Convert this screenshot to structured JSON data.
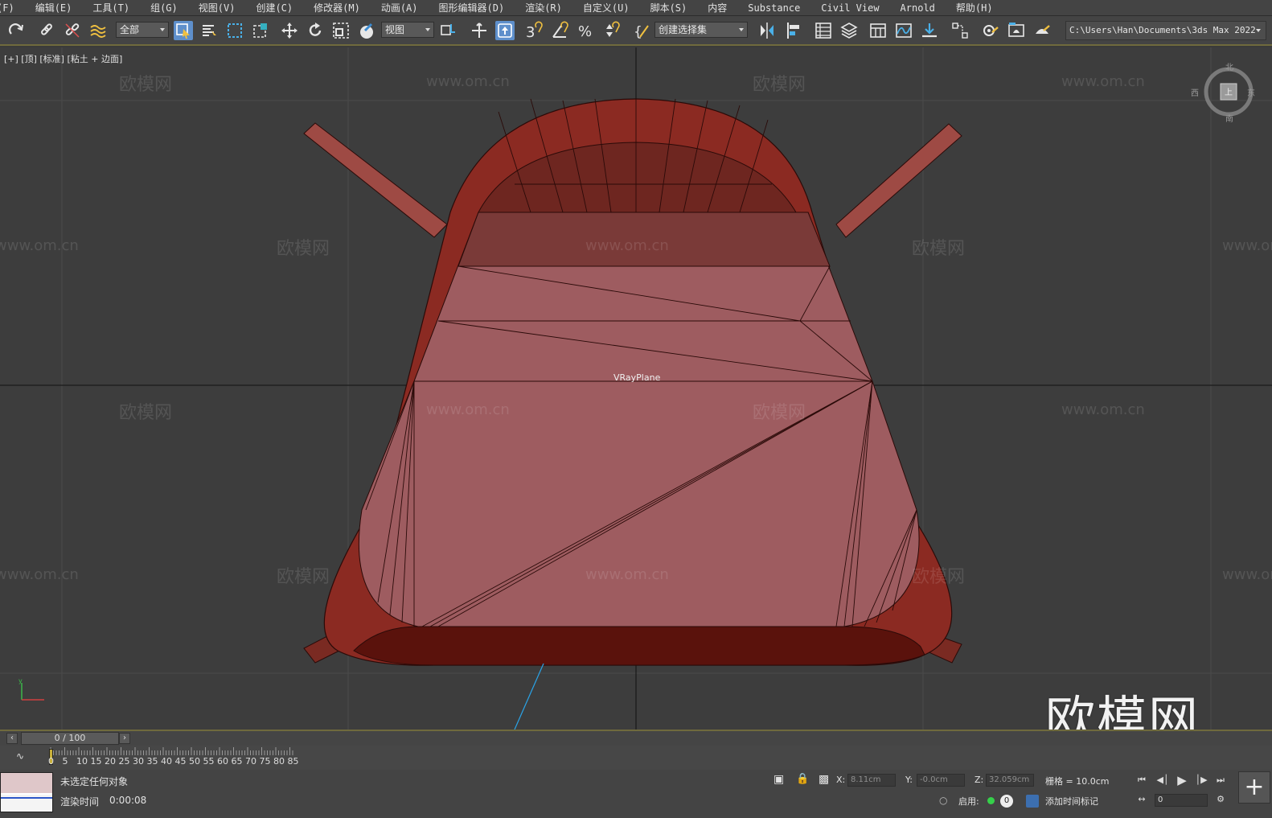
{
  "menu": [
    "(F)",
    "编辑(E)",
    "工具(T)",
    "组(G)",
    "视图(V)",
    "创建(C)",
    "修改器(M)",
    "动画(A)",
    "图形编辑器(D)",
    "渲染(R)",
    "自定义(U)",
    "脚本(S)",
    "内容",
    "Substance",
    "Civil View",
    "Arnold",
    "帮助(H)"
  ],
  "toolbar": {
    "filter_value": "全部",
    "refcoord_value": "视图",
    "named_selection_value": "创建选择集",
    "project_path": "C:\\Users\\Han\\Documents\\3ds Max 2022"
  },
  "viewport": {
    "label": "[+] [顶] [标准] [粘土 + 边面]",
    "object_label": "VRayPlane",
    "watermark_text": "欧模网",
    "watermark_url": "www.om.cn",
    "logo_text": "欧模网",
    "navcube": {
      "north": "北",
      "south": "南",
      "east": "东",
      "west": "西",
      "face": "上"
    },
    "model_colors": {
      "base": "#9e4a44",
      "rim": "#8b2a22",
      "dark": "#5a120c",
      "face": "#a06468",
      "edge": "#2a0a08"
    }
  },
  "timeline": {
    "frame_display": "0 / 100",
    "ticks": [
      "0",
      "5",
      "10",
      "15",
      "20",
      "25",
      "30",
      "35",
      "40",
      "45",
      "50",
      "55",
      "60",
      "65",
      "70",
      "75",
      "80",
      "85"
    ]
  },
  "status": {
    "selection": "未选定任何对象",
    "render_time_label": "渲染时间",
    "render_time": "0:00:08",
    "x_label": "X:",
    "x_value": "8.11cm",
    "y_label": "Y:",
    "y_value": "-0.0cm",
    "z_label": "Z:",
    "z_value": "32.059cm",
    "grid_label": "栅格 = 10.0cm",
    "enable_label": "启用:",
    "enable_count": "0",
    "add_time_tag": "添加时间标记",
    "frame_field": "0"
  }
}
